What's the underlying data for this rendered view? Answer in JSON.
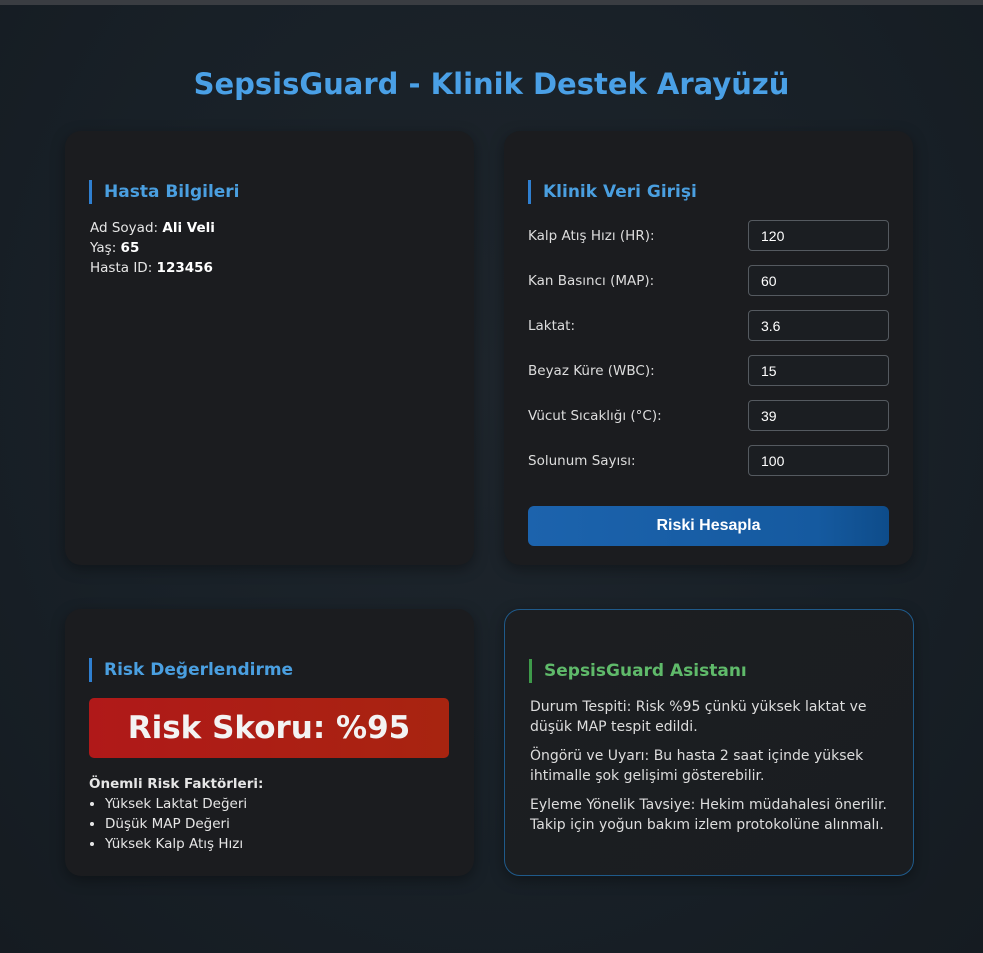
{
  "title": "SepsisGuard - Klinik Destek Arayüzü",
  "patient": {
    "heading": "Hasta Bilgileri",
    "name_label": "Ad Soyad:",
    "name": "Ali Veli",
    "age_label": "Yaş:",
    "age": "65",
    "id_label": "Hasta ID:",
    "id": "123456"
  },
  "clinical": {
    "heading": "Klinik Veri Girişi",
    "fields": [
      {
        "label": "Kalp Atış Hızı (HR):",
        "value": "120"
      },
      {
        "label": "Kan Basıncı (MAP):",
        "value": "60"
      },
      {
        "label": "Laktat:",
        "value": "3.6"
      },
      {
        "label": "Beyaz Küre (WBC):",
        "value": "15"
      },
      {
        "label": "Vücut Sıcaklığı (°C):",
        "value": "39"
      },
      {
        "label": "Solunum Sayısı:",
        "value": "100"
      }
    ],
    "button": "Riski Hesapla"
  },
  "risk": {
    "heading": "Risk Değerlendirme",
    "score": "Risk Skoru: %95",
    "factors_label": "Önemli Risk Faktörleri:",
    "factors": [
      "Yüksek Laktat Değeri",
      "Düşük MAP Değeri",
      "Yüksek Kalp Atış Hızı"
    ]
  },
  "assistant": {
    "heading": "SepsisGuard Asistanı",
    "paragraphs": [
      "Durum Tespiti: Risk %95 çünkü yüksek laktat ve düşük MAP tespit edildi.",
      "Öngörü ve Uyarı: Bu hasta 2 saat içinde yüksek ihtimalle şok gelişimi gösterebilir.",
      "Eyleme Yönelik Tavsiye: Hekim müdahalesi önerilir. Takip için yoğun bakım izlem protokolüne alınmalı."
    ]
  }
}
